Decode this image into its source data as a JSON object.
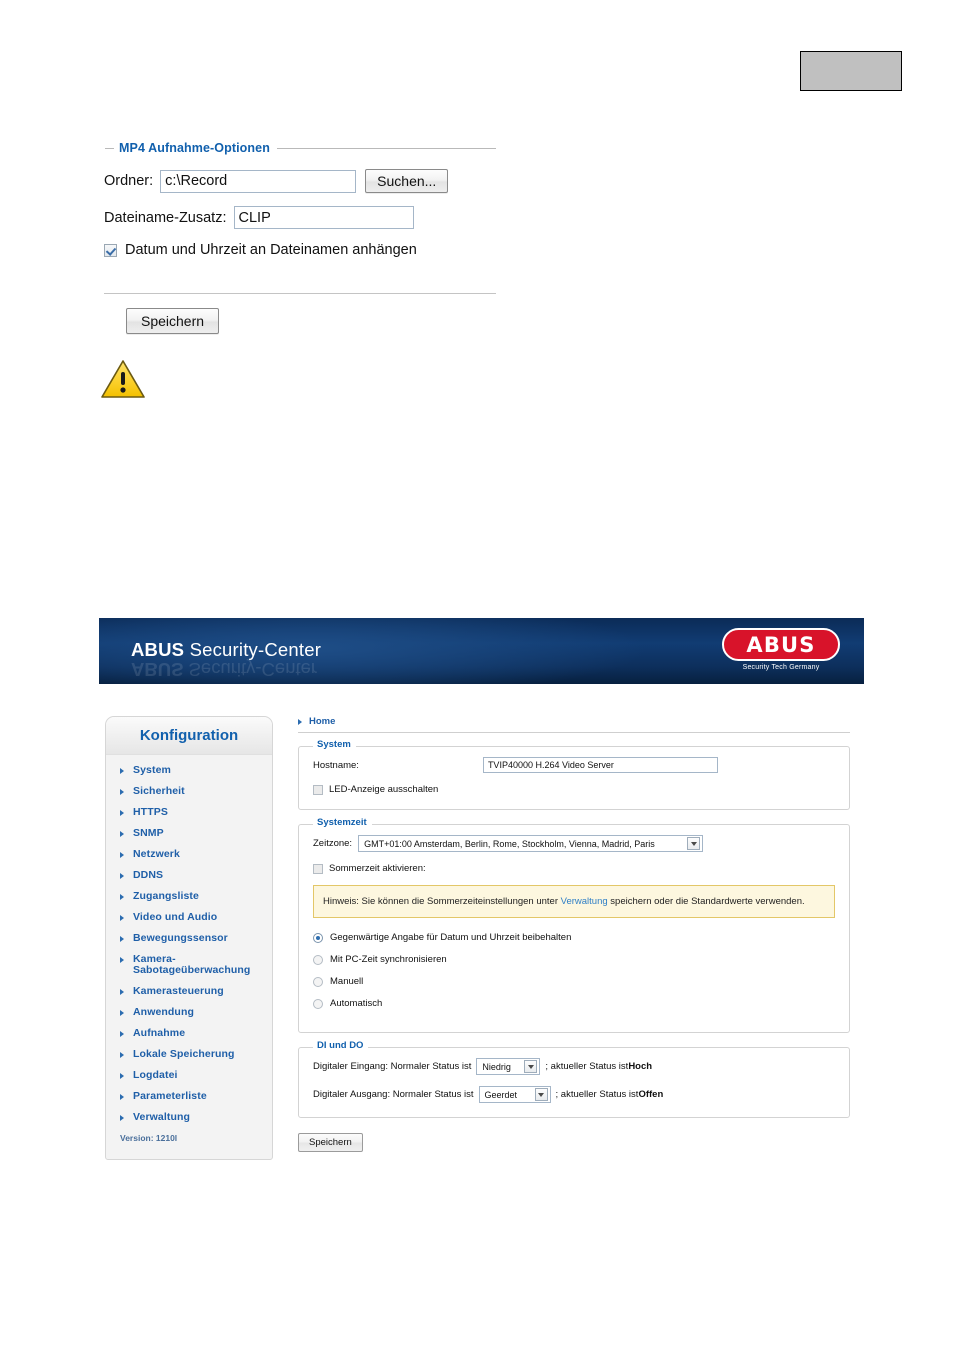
{
  "doc_section": {
    "legend": "MP4 Aufnahme-Optionen",
    "folder_label": "Ordner:",
    "folder_value": "c:\\Record",
    "browse_button": "Suchen...",
    "filename_label": "Dateiname-Zusatz:",
    "filename_value": "CLIP",
    "append_datetime_label": "Datum und Uhrzeit an Dateinamen anhängen",
    "save_button": "Speichern"
  },
  "app": {
    "banner": {
      "brand": "ABUS",
      "title": " Security-Center",
      "logo_text": "ABUS",
      "logo_subtitle": "Security Tech Germany"
    },
    "sidebar": {
      "header": "Konfiguration",
      "items": [
        {
          "label": "System"
        },
        {
          "label": "Sicherheit"
        },
        {
          "label": "HTTPS"
        },
        {
          "label": "SNMP"
        },
        {
          "label": "Netzwerk"
        },
        {
          "label": "DDNS"
        },
        {
          "label": "Zugangsliste"
        },
        {
          "label": "Video und Audio"
        },
        {
          "label": "Bewegungssensor"
        },
        {
          "label": "Kamera-\nSabotageüberwachung"
        },
        {
          "label": "Kamerasteuerung"
        },
        {
          "label": "Anwendung"
        },
        {
          "label": "Aufnahme"
        },
        {
          "label": "Lokale Speicherung"
        },
        {
          "label": "Logdatei"
        },
        {
          "label": "Parameterliste"
        },
        {
          "label": "Verwaltung"
        }
      ],
      "version": "Version: 1210l"
    },
    "breadcrumb": "Home",
    "system_panel": {
      "legend": "System",
      "hostname_label": "Hostname:",
      "hostname_value": "TVIP40000 H.264 Video Server",
      "led_off_label": "LED-Anzeige ausschalten"
    },
    "systemtime_panel": {
      "legend": "Systemzeit",
      "timezone_label": "Zeitzone:",
      "timezone_value": "GMT+01:00 Amsterdam, Berlin, Rome, Stockholm, Vienna, Madrid, Paris",
      "dst_label": "Sommerzeit aktivieren:",
      "notice_prefix": "Hinweis: Sie können die Sommerzeiteinstellungen unter ",
      "notice_link": "Verwaltung",
      "notice_suffix": " speichern oder die Standardwerte verwenden.",
      "options": [
        {
          "label": "Gegenwärtige Angabe für Datum und Uhrzeit beibehalten",
          "selected": true
        },
        {
          "label": "Mit PC-Zeit synchronisieren",
          "selected": false
        },
        {
          "label": "Manuell",
          "selected": false
        },
        {
          "label": "Automatisch",
          "selected": false
        }
      ]
    },
    "dido_panel": {
      "legend": "DI und DO",
      "di_label": "Digitaler Eingang: Normaler Status ist",
      "di_value": "Niedrig",
      "di_status_prefix": "; aktueller Status ist ",
      "di_status_value": "Hoch",
      "do_label": "Digitaler Ausgang: Normaler Status ist",
      "do_value": "Geerdet",
      "do_status_prefix": "; aktueller Status ist ",
      "do_status_value": "Offen"
    },
    "save_button": "Speichern"
  }
}
